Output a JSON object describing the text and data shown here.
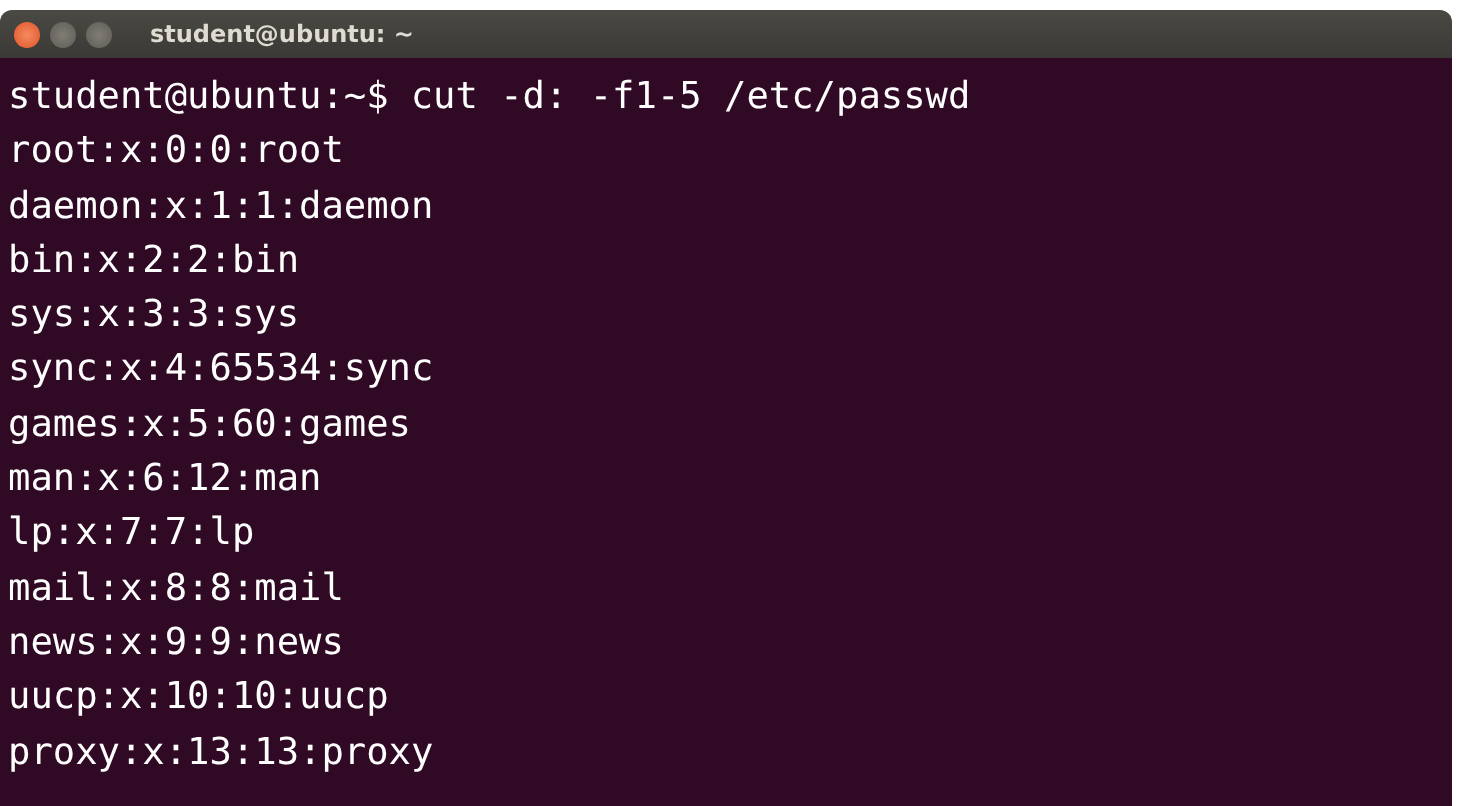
{
  "window": {
    "title": "student@ubuntu: ~"
  },
  "terminal": {
    "prompt": "student@ubuntu:~$",
    "command": "cut -d: -f1-5 /etc/passwd",
    "output": [
      "root:x:0:0:root",
      "daemon:x:1:1:daemon",
      "bin:x:2:2:bin",
      "sys:x:3:3:sys",
      "sync:x:4:65534:sync",
      "games:x:5:60:games",
      "man:x:6:12:man",
      "lp:x:7:7:lp",
      "mail:x:8:8:mail",
      "news:x:9:9:news",
      "uucp:x:10:10:uucp",
      "proxy:x:13:13:proxy"
    ]
  }
}
